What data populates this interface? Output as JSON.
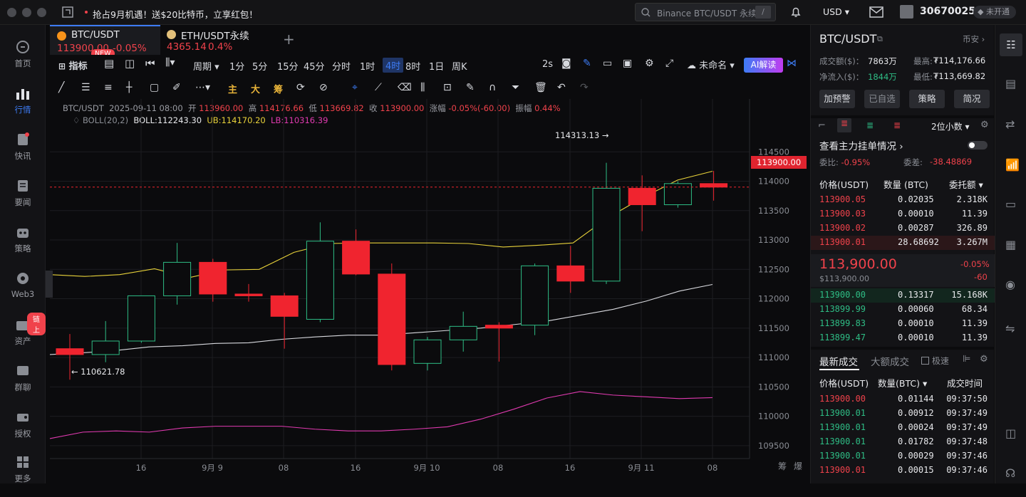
{
  "topbar": {
    "promo": "抢占9月机遇！送$20比特币，立享红包！",
    "search_placeholder": "Binance BTC/USDT 永续",
    "search_shortcut": "/",
    "currency": "USD",
    "user_id": "30670025",
    "account_status": "未开通"
  },
  "sidebar": {
    "items": [
      {
        "label": "首页",
        "icon": "home-icon"
      },
      {
        "label": "行情",
        "icon": "market-icon"
      },
      {
        "label": "快讯",
        "icon": "flash-icon"
      },
      {
        "label": "要闻",
        "icon": "news-icon"
      },
      {
        "label": "策略",
        "icon": "robot-icon"
      },
      {
        "label": "Web3",
        "icon": "web3-icon"
      },
      {
        "label": "资产",
        "icon": "wallet-icon",
        "badge": "链上"
      },
      {
        "label": "群聊",
        "icon": "chat-icon"
      },
      {
        "label": "授权",
        "icon": "key-icon"
      },
      {
        "label": "更多",
        "icon": "more-icon"
      }
    ]
  },
  "tabs": [
    {
      "symbol": "BTC/USDT",
      "price": "113900.00",
      "change": "-0.05%",
      "badge": "NEW"
    },
    {
      "symbol": "ETH/USDT永续",
      "price": "4365.14",
      "change": "0.4%"
    }
  ],
  "toolbar": {
    "indicator": "指标",
    "period": "周期",
    "intervals": [
      "1分",
      "5分",
      "15分",
      "45分",
      "分时",
      "1时",
      "4时",
      "8时",
      "1日",
      "周K"
    ],
    "active_interval": "4时",
    "speed": "2s",
    "layout_name": "未命名",
    "ai_button": "AI解读"
  },
  "drawtools": {
    "main": "主",
    "big": "大",
    "chip": "筹"
  },
  "chart_info": {
    "symbol": "BTC/USDT",
    "time": "2025-09-11 08:00",
    "open_label": "开",
    "open": "113960.00",
    "high_label": "高",
    "high": "114176.66",
    "low_label": "低",
    "low": "113669.82",
    "close_label": "收",
    "close": "113900.00",
    "chg_label": "涨幅",
    "chg": "-0.05%(-60.00)",
    "amp_label": "振幅",
    "amp": "0.44%",
    "boll_name": "BOLL(20,2)",
    "boll_mid": "BOLL:112243.30",
    "boll_ub": "UB:114170.20",
    "boll_lb": "LB:110316.39",
    "high_mark": "114313.13 →",
    "low_mark": "← 110621.78",
    "last_price": "113900.00",
    "corner_labels": [
      "筹",
      "爆"
    ]
  },
  "chart_data": {
    "type": "candlestick",
    "y_ticks": [
      114500,
      114000,
      113500,
      113000,
      112500,
      112000,
      111500,
      111000,
      110500,
      110000,
      109500
    ],
    "ylim": [
      109280,
      115400
    ],
    "x_ticks": [
      "16",
      "9月 9",
      "08",
      "16",
      "9月 10",
      "08",
      "16",
      "9月 11",
      "08"
    ],
    "candles": [
      {
        "o": 111150,
        "h": 111400,
        "l": 110621.78,
        "c": 111050
      },
      {
        "o": 111050,
        "h": 111620,
        "l": 110920,
        "c": 111280
      },
      {
        "o": 111280,
        "h": 111900,
        "l": 111250,
        "c": 112050
      },
      {
        "o": 112050,
        "h": 112950,
        "l": 111900,
        "c": 112620
      },
      {
        "o": 112620,
        "h": 112680,
        "l": 111950,
        "c": 112080
      },
      {
        "o": 112080,
        "h": 112250,
        "l": 111950,
        "c": 112050
      },
      {
        "o": 112050,
        "h": 112100,
        "l": 111150,
        "c": 111700
      },
      {
        "o": 111650,
        "h": 113300,
        "l": 111600,
        "c": 112980
      },
      {
        "o": 112980,
        "h": 113180,
        "l": 112400,
        "c": 112420
      },
      {
        "o": 112420,
        "h": 112600,
        "l": 110780,
        "c": 110880
      },
      {
        "o": 110900,
        "h": 111350,
        "l": 110780,
        "c": 111300
      },
      {
        "o": 111300,
        "h": 111780,
        "l": 111100,
        "c": 111530
      },
      {
        "o": 111550,
        "h": 111600,
        "l": 110930,
        "c": 111500
      },
      {
        "o": 111550,
        "h": 112600,
        "l": 111380,
        "c": 112560
      },
      {
        "o": 112560,
        "h": 112900,
        "l": 112100,
        "c": 112300
      },
      {
        "o": 112300,
        "h": 114313.13,
        "l": 112250,
        "c": 113880
      },
      {
        "o": 113880,
        "h": 114100,
        "l": 113150,
        "c": 113600
      },
      {
        "o": 113600,
        "h": 114000,
        "l": 113550,
        "c": 113960
      },
      {
        "o": 113960,
        "h": 114176.66,
        "l": 113669.82,
        "c": 113900
      }
    ],
    "boll_ub": [
      112410,
      112380,
      112410,
      112510,
      112360,
      112490,
      112500,
      112790,
      112940,
      112950,
      112950,
      112950,
      112940,
      112880,
      112910,
      112950,
      113380,
      113720,
      114020,
      114170.2
    ],
    "boll_mid": [
      111050,
      111080,
      111120,
      111180,
      111200,
      111240,
      111250,
      111310,
      111350,
      111380,
      111380,
      111420,
      111460,
      111500,
      111560,
      111620,
      111720,
      111820,
      111960,
      112130,
      112243.3
    ],
    "boll_lb": [
      109620,
      109730,
      109750,
      109730,
      109800,
      109830,
      109830,
      109830,
      109780,
      109750,
      109750,
      109780,
      109820,
      109950,
      110120,
      110310,
      110420,
      110360,
      110330,
      110300,
      110316.39
    ]
  },
  "panel": {
    "symbol": "BTC/USDT",
    "exchange": "币安",
    "turnover_label": "成交额($)：",
    "turnover": "7863万",
    "high_label": "最高:",
    "high": "₮114,176.66",
    "inflow_label": "净流入($)：",
    "inflow": "1844万",
    "low_label": "最低:",
    "low": "₮113,669.82",
    "buttons": [
      "加预警",
      "已自选",
      "策略",
      "简况"
    ],
    "precision": "2位小数",
    "orderbook_title": "查看主力挂单情况",
    "ratio_label": "委比:",
    "ratio": "-0.95%",
    "diff_label": "委差:",
    "diff": "-38.48869",
    "col_price": "价格(USDT)",
    "col_qty": "数量 (BTC)",
    "col_total": "委托额",
    "asks": [
      [
        "113900.05",
        "0.02035",
        "2.318K"
      ],
      [
        "113900.03",
        "0.00010",
        "11.39"
      ],
      [
        "113900.02",
        "0.00287",
        "326.89"
      ],
      [
        "113900.01",
        "28.68692",
        "3.267M"
      ]
    ],
    "mid_price": "113,900.00",
    "mid_usd": "$113,900.00",
    "mid_chg": "-0.05%",
    "mid_diff": "-60",
    "bids": [
      [
        "113900.00",
        "0.13317",
        "15.168K"
      ],
      [
        "113899.99",
        "0.00060",
        "68.34"
      ],
      [
        "113899.83",
        "0.00010",
        "11.39"
      ],
      [
        "113899.47",
        "0.00010",
        "11.39"
      ]
    ],
    "trades_tab": "最新成交",
    "big_tab": "大额成交",
    "fast_label": "极速",
    "t_col_price": "价格(USDT)",
    "t_col_qty": "数量(BTC)",
    "t_col_time": "成交时间",
    "trades": [
      [
        "113900.00",
        "0.01144",
        "09:37:50",
        "red"
      ],
      [
        "113900.01",
        "0.00912",
        "09:37:49",
        "green"
      ],
      [
        "113900.01",
        "0.00024",
        "09:37:49",
        "green"
      ],
      [
        "113900.01",
        "0.01782",
        "09:37:48",
        "green"
      ],
      [
        "113900.01",
        "0.00029",
        "09:37:46",
        "green"
      ],
      [
        "113900.01",
        "0.00015",
        "09:37:46",
        "red"
      ]
    ]
  }
}
